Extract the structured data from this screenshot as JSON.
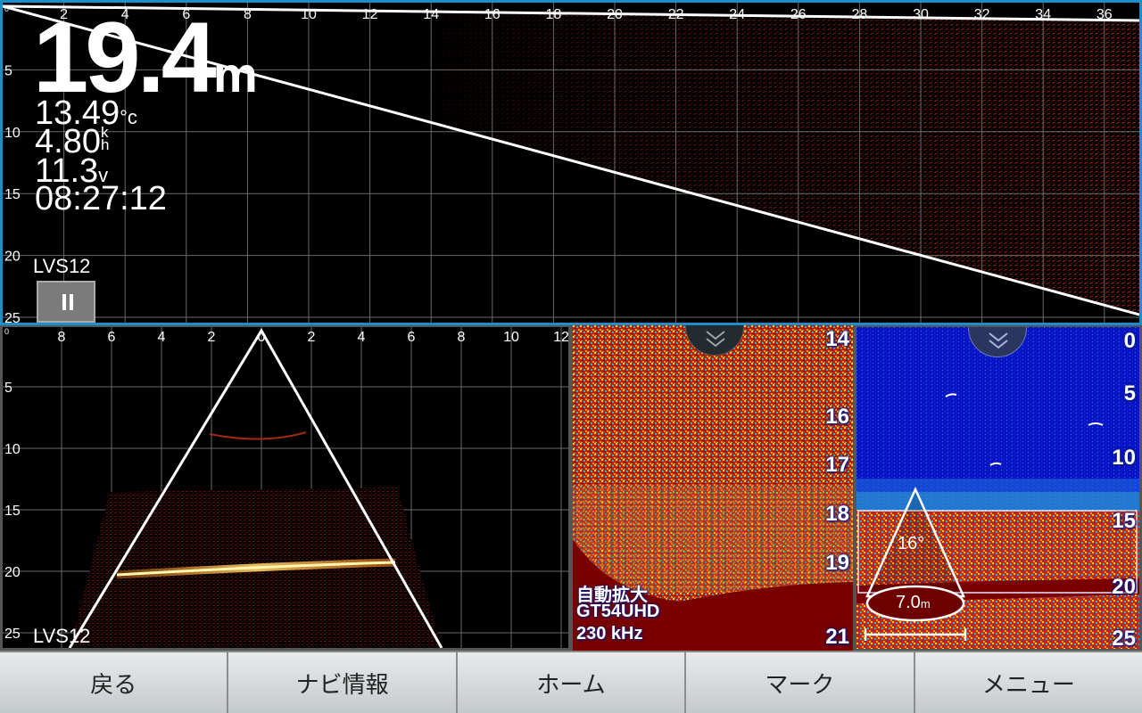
{
  "top_pane": {
    "scale_origin": "0",
    "x_ticks": [
      "2",
      "4",
      "6",
      "8",
      "10",
      "12",
      "14",
      "16",
      "18",
      "20",
      "22",
      "24",
      "26",
      "28",
      "30",
      "32",
      "34",
      "36"
    ],
    "y_ticks": [
      "5",
      "10",
      "15",
      "20",
      "25"
    ],
    "depth": "19.4",
    "depth_unit": "m",
    "temperature": "13.49",
    "temperature_unit": "°c",
    "speed": "4.80",
    "speed_unit_top": "k",
    "speed_unit_bottom": "h",
    "voltage": "11.3",
    "voltage_unit": "v",
    "time": "08:27:12",
    "transducer": "LVS12",
    "pause_icon": "pause-icon"
  },
  "bottom_left_pane": {
    "scale_origin": "0",
    "x_ticks": [
      "8",
      "6",
      "4",
      "2",
      "0",
      "2",
      "4",
      "6",
      "8",
      "10",
      "12"
    ],
    "y_ticks": [
      "5",
      "10",
      "15",
      "20",
      "25"
    ],
    "transducer": "LVS12"
  },
  "bottom_middle_pane": {
    "depth_scale": [
      "14",
      "16",
      "17",
      "18",
      "19",
      "21"
    ],
    "zoom_label": "自動拡大",
    "transducer": "GT54UHD",
    "frequency": "230 kHz",
    "chevron_icon": "chevron-down-icon"
  },
  "bottom_right_pane": {
    "depth_scale": [
      "0",
      "5",
      "10",
      "15",
      "20",
      "25"
    ],
    "cone_angle": "16°",
    "cone_diameter": "7.0",
    "cone_diameter_unit": "m",
    "chevron_icon": "chevron-down-icon"
  },
  "bottom_bar": {
    "back": "戻る",
    "nav_info": "ナビ情報",
    "home": "ホーム",
    "mark": "マーク",
    "menu": "メニュー"
  },
  "colors": {
    "frame_active": "#1a8fc9",
    "echo_red": "#8a1a0c",
    "sonar_blue": "#0a16c8",
    "button_bar": "#d8dcde"
  }
}
